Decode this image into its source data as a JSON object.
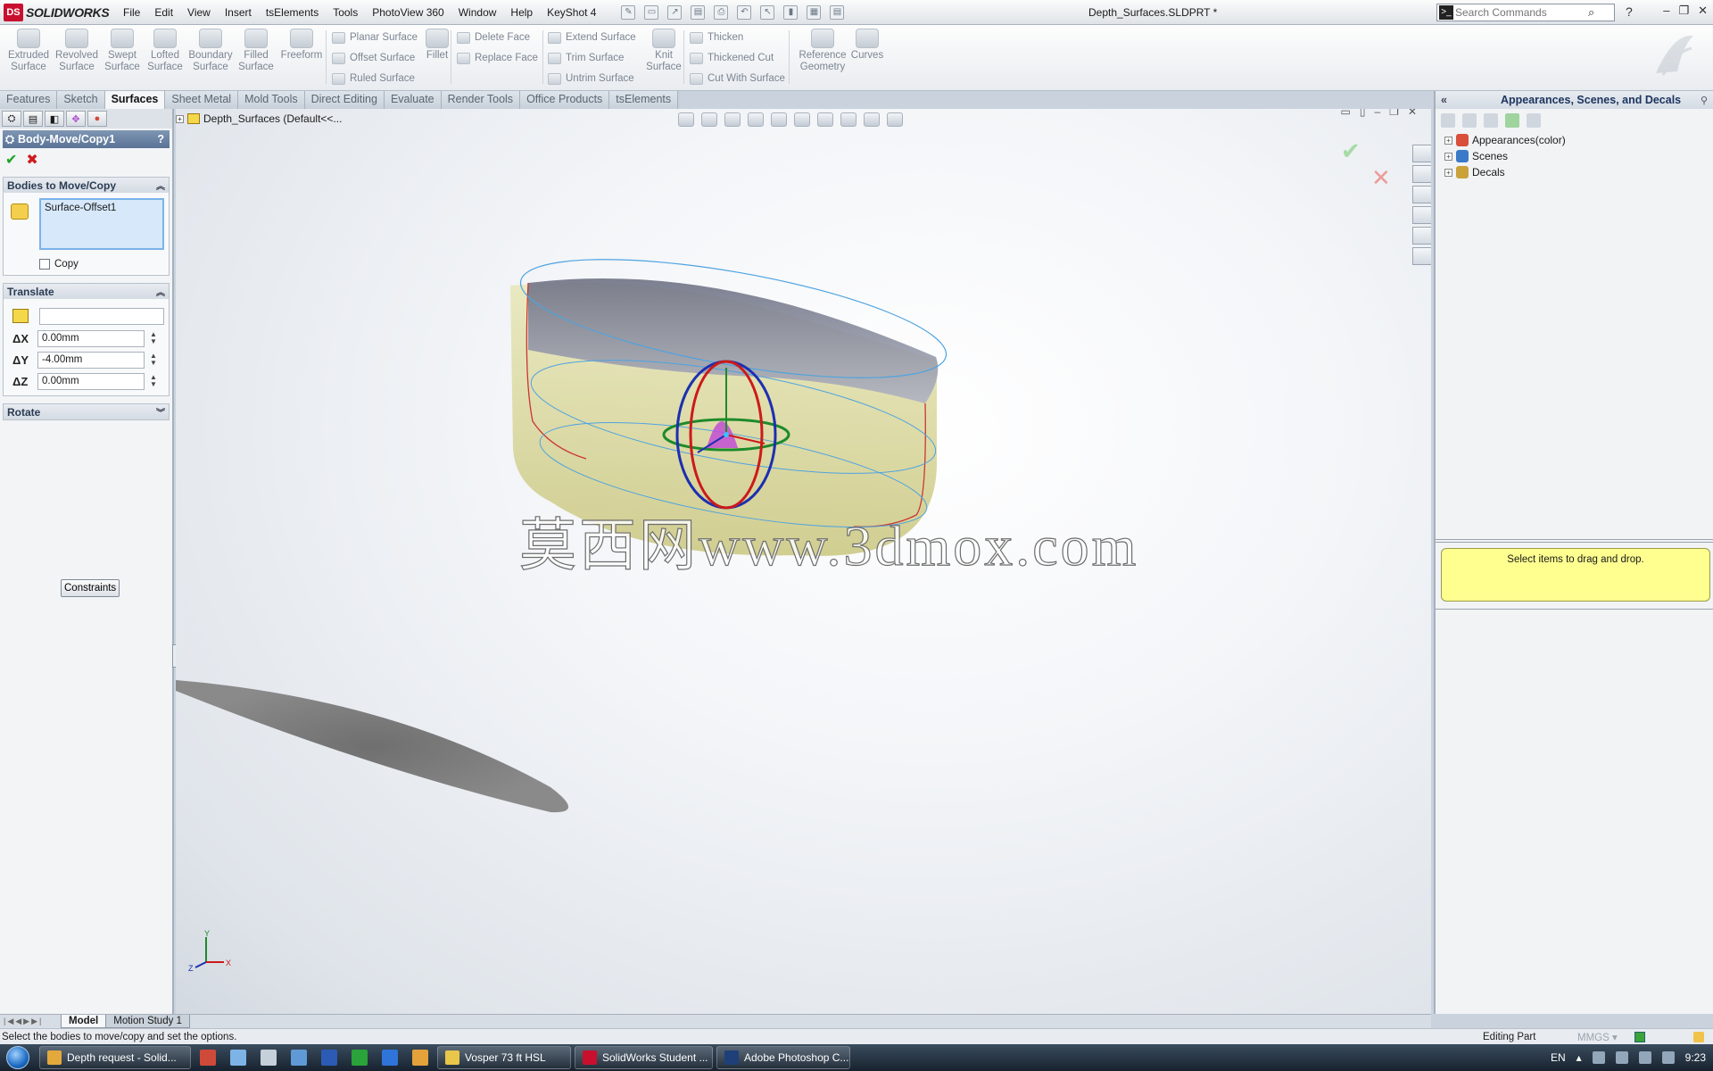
{
  "app": {
    "brand": "SOLIDWORKS",
    "ds_mark": "DS",
    "document_title": "Depth_Surfaces.SLDPRT *"
  },
  "menu": [
    "File",
    "Edit",
    "View",
    "Insert",
    "tsElements",
    "Tools",
    "PhotoView 360",
    "Window",
    "Help",
    "KeyShot 4"
  ],
  "search": {
    "placeholder": "Search Commands"
  },
  "command_manager": {
    "big_buttons": [
      {
        "label": "Extruded\nSurface"
      },
      {
        "label": "Revolved\nSurface"
      },
      {
        "label": "Swept\nSurface"
      },
      {
        "label": "Lofted\nSurface"
      },
      {
        "label": "Boundary\nSurface"
      },
      {
        "label": "Filled\nSurface"
      },
      {
        "label": "Freeform"
      },
      {
        "label": "Fillet"
      },
      {
        "label": "Knit\nSurface"
      },
      {
        "label": "Reference\nGeometry"
      },
      {
        "label": "Curves"
      }
    ],
    "small_buttons": [
      {
        "label": "Planar Surface"
      },
      {
        "label": "Offset Surface"
      },
      {
        "label": "Ruled Surface"
      },
      {
        "label": "Delete Face"
      },
      {
        "label": "Replace Face"
      },
      {
        "label": "Extend Surface"
      },
      {
        "label": "Trim Surface"
      },
      {
        "label": "Untrim Surface"
      },
      {
        "label": "Thicken"
      },
      {
        "label": "Thickened Cut"
      },
      {
        "label": "Cut With Surface"
      }
    ]
  },
  "tabs": [
    "Features",
    "Sketch",
    "Surfaces",
    "Sheet Metal",
    "Mold Tools",
    "Direct Editing",
    "Evaluate",
    "Render Tools",
    "Office Products",
    "tsElements"
  ],
  "active_tab": "Surfaces",
  "property_manager": {
    "title": "Body-Move/Copy1",
    "help": "?",
    "ok_symbol": "✔",
    "cancel_symbol": "✖",
    "bodies_group": {
      "title": "Bodies to Move/Copy",
      "items": [
        "Surface-Offset1"
      ],
      "copy_label": "Copy",
      "copy_checked": false
    },
    "translate_group": {
      "title": "Translate",
      "dx_label": "ΔX",
      "dx_value": "0.00mm",
      "dy_label": "ΔY",
      "dy_value": "-4.00mm",
      "dz_label": "ΔZ",
      "dz_value": "0.00mm"
    },
    "rotate_group": {
      "title": "Rotate"
    },
    "constraints_label": "Constraints"
  },
  "graphics": {
    "flyout_tree_label": "Depth_Surfaces  (Default<<...",
    "watermark": "莫西网www.3dmox.com",
    "triad": {
      "x": "X",
      "y": "Y",
      "z": "Z"
    }
  },
  "task_pane": {
    "title": "Appearances, Scenes, and Decals",
    "tree": [
      {
        "label": "Appearances(color)",
        "color": "#d84f3a"
      },
      {
        "label": "Scenes",
        "color": "#3a7ac8"
      },
      {
        "label": "Decals",
        "color": "#c9a23a"
      }
    ],
    "drag_hint": "Select items to drag and drop."
  },
  "bottom_tabs": [
    "Model",
    "Motion Study 1"
  ],
  "active_bottom_tab": "Model",
  "status": {
    "message": "Select the bodies to move/copy and set the options.",
    "mode": "Editing Part",
    "units": "MMGS ▾"
  },
  "taskbar": {
    "items": [
      {
        "label": "Depth request - Solid...",
        "color": "#e4a93c"
      },
      {
        "label": "Vosper 73 ft HSL",
        "color": "#e8c64a"
      },
      {
        "label": "SolidWorks Student ...",
        "color": "#c8102e"
      },
      {
        "label": "Adobe Photoshop C...",
        "color": "#1e3f78"
      }
    ],
    "pins": [
      {
        "color": "#d04a3a"
      },
      {
        "color": "#7eb3e6"
      },
      {
        "color": "#c6d0da"
      },
      {
        "color": "#5f9ad6"
      },
      {
        "color": "#2b5bb5"
      },
      {
        "color": "#2aa33a"
      },
      {
        "color": "#2f74d8"
      },
      {
        "color": "#e3a23a"
      }
    ],
    "lang": "EN",
    "time": "9:23"
  }
}
